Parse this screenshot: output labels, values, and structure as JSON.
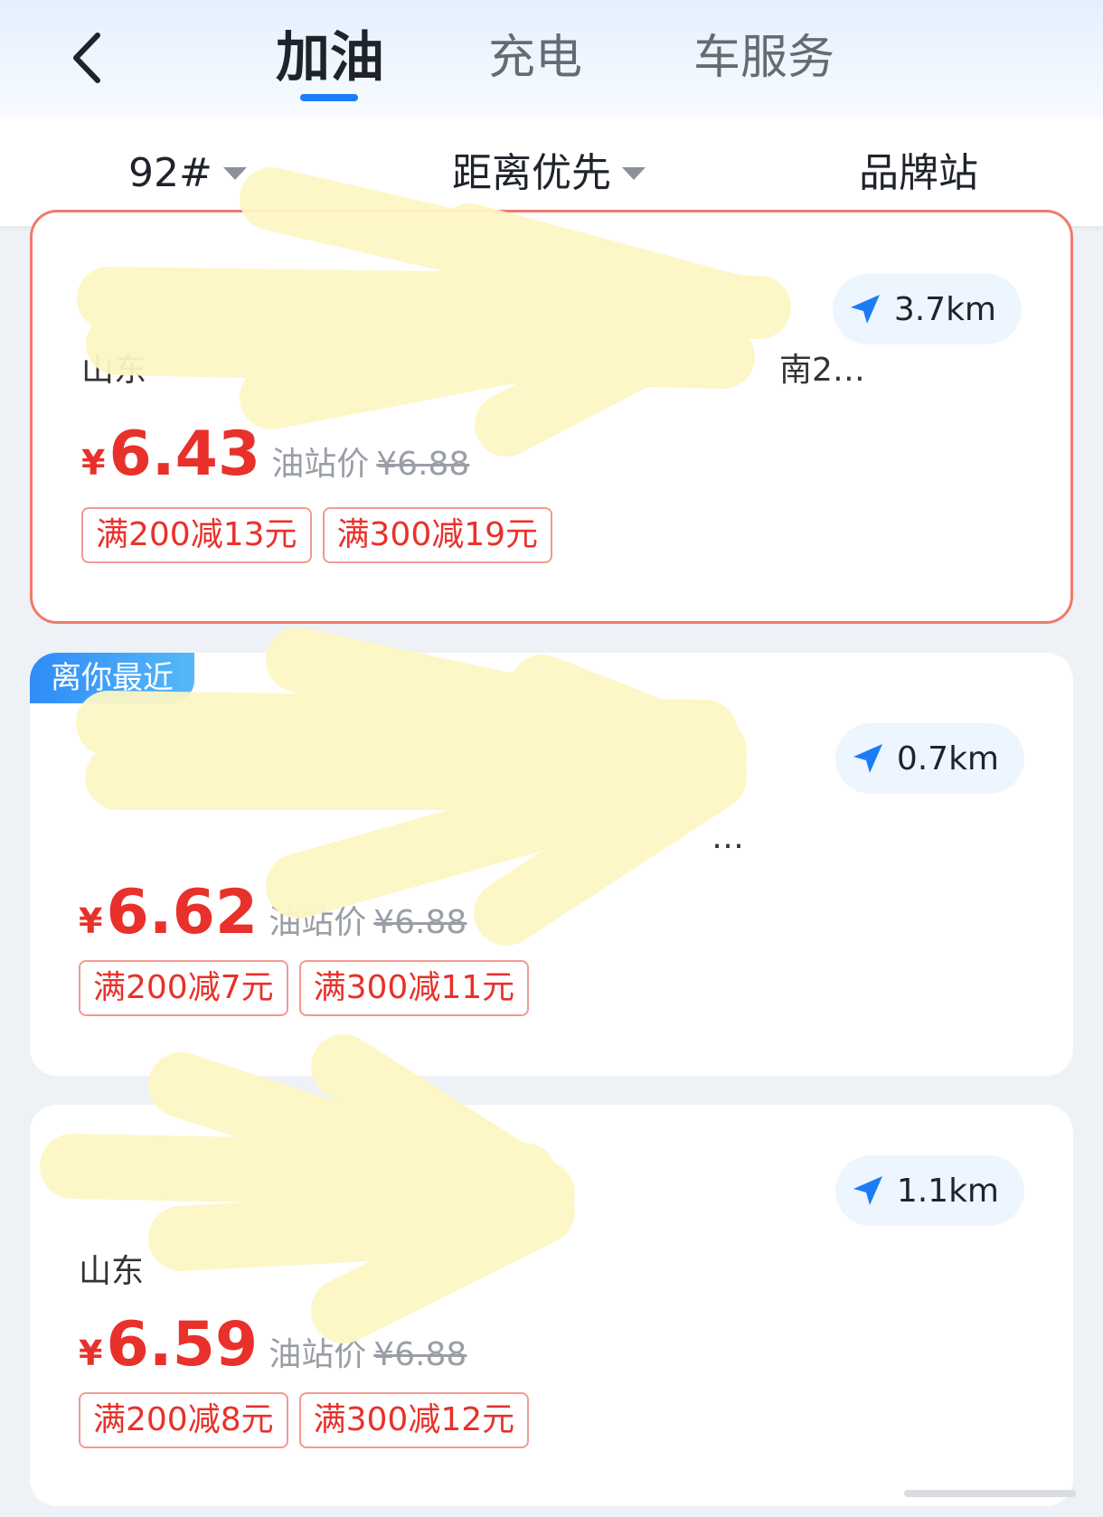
{
  "header": {
    "back_icon": "chevron-left-icon",
    "tabs": [
      {
        "label": "加油",
        "active": true
      },
      {
        "label": "充电",
        "active": false
      },
      {
        "label": "车服务",
        "active": false
      }
    ],
    "accent_color": "#1b7cf5"
  },
  "filters": {
    "fuel_type": "92#",
    "sort": "距离优先",
    "brand": "品牌站"
  },
  "colors": {
    "price_red": "#e8312a",
    "badge_blue": "#2e8cf7",
    "card_highlight_border": "#f07a6b"
  },
  "stations": [
    {
      "name": "",
      "address": "山东",
      "address_tail": "南2…",
      "distance": "3.7km",
      "price_currency": "¥",
      "price": "6.43",
      "station_price_label": "油站价",
      "station_price": "¥6.88",
      "coupons": [
        "满200减13元",
        "满300减19元"
      ]
    },
    {
      "badge": "离你最近",
      "name": "",
      "address": "",
      "address_tail": "…",
      "distance": "0.7km",
      "price_currency": "¥",
      "price": "6.62",
      "station_price_label": "油站价",
      "station_price": "¥6.88",
      "coupons": [
        "满200减7元",
        "满300减11元"
      ]
    },
    {
      "name": "",
      "address": "山东",
      "address_tail": "",
      "distance": "1.1km",
      "price_currency": "¥",
      "price": "6.59",
      "station_price_label": "油站价",
      "station_price": "¥6.88",
      "coupons": [
        "满200减8元",
        "满300减12元"
      ]
    }
  ]
}
